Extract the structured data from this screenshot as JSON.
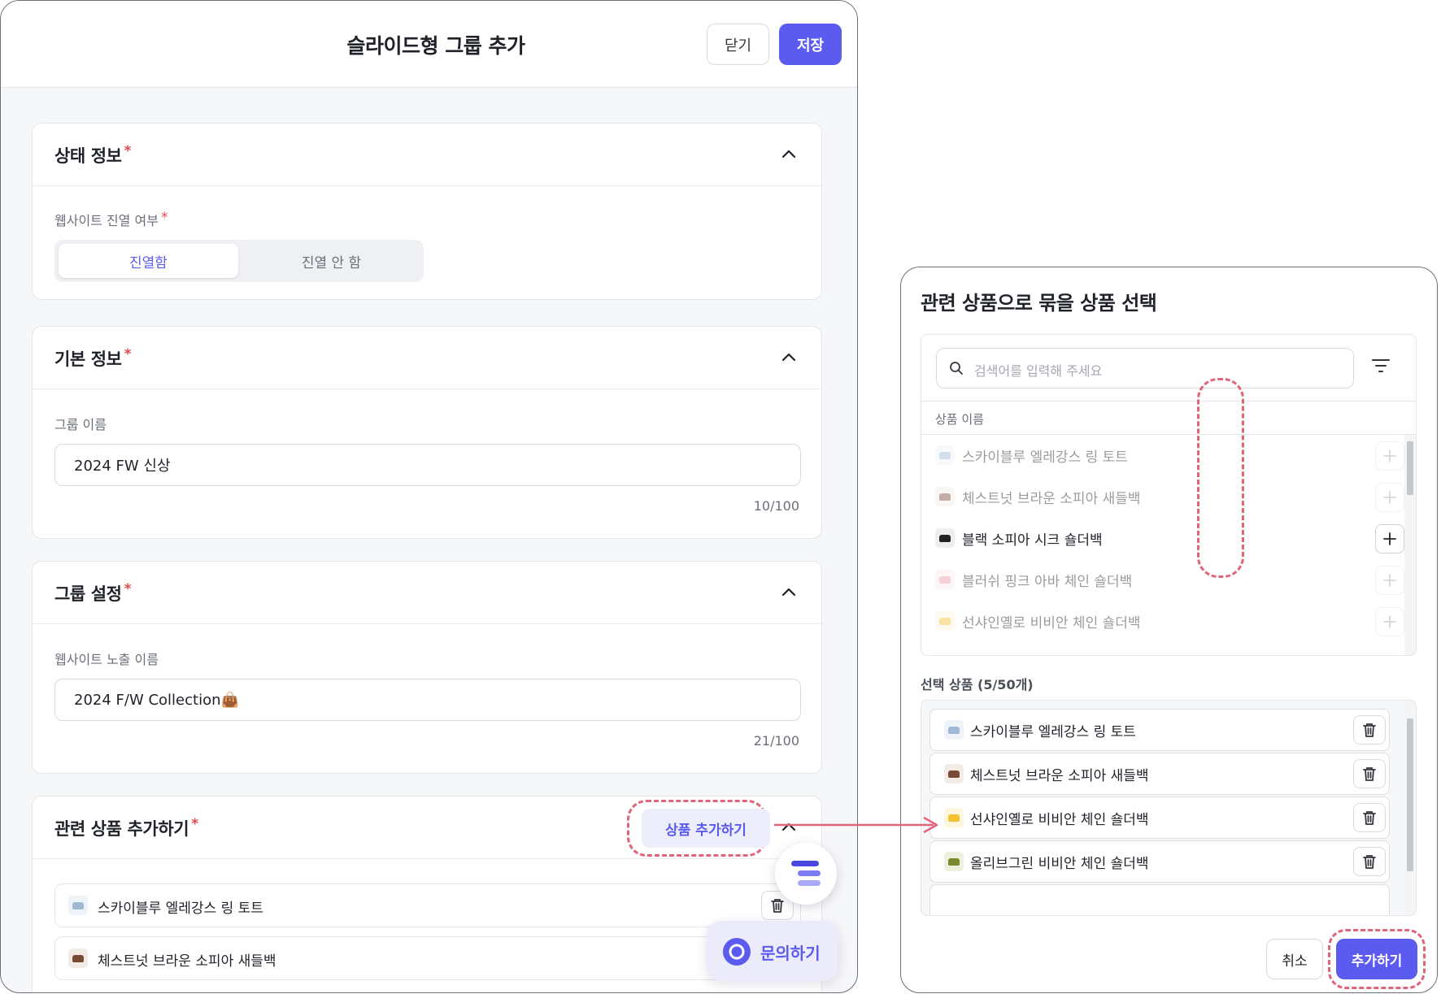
{
  "group_editor": {
    "title": "슬라이드형 그룹 추가",
    "close_label": "닫기",
    "save_label": "저장",
    "status_section": {
      "title": "상태 정보",
      "required_mark": "*",
      "display_label": "웹사이트 진열 여부",
      "display_on": "진열함",
      "display_off": "진열 안 함"
    },
    "basic_section": {
      "title": "기본 정보",
      "required_mark": "*",
      "group_name_label": "그룹 이름",
      "group_name_value": "2024 FW 신상",
      "group_name_count": "10/100"
    },
    "settings_section": {
      "title": "그룹 설정",
      "required_mark": "*",
      "exposure_label": "웹사이트 노출 이름",
      "exposure_value": "2024 F/W Collection👜",
      "exposure_count": "21/100"
    },
    "related_section": {
      "title": "관련 상품 추가하기",
      "required_mark": "*",
      "add_button": "상품 추가하기",
      "items": [
        {
          "name": "스카이블루 엘레강스 링 토트",
          "color": "#9fb8d6"
        },
        {
          "name": "체스트넛 브라운 소피아 새들백",
          "color": "#7a4a35"
        }
      ]
    },
    "inquiry_label": "문의하기"
  },
  "product_picker": {
    "title": "관련 상품으로 묶을 상품 선택",
    "search_placeholder": "검색어를 입력해 주세요",
    "column_header": "상품 이름",
    "list": [
      {
        "name": "스카이블루 엘레강스 링 토트",
        "color": "#9fb8d6",
        "selected": true
      },
      {
        "name": "체스트넛 브라운 소피아 새들백",
        "color": "#7a4a35",
        "selected": true
      },
      {
        "name": "블랙 소피아 시크 숄더백",
        "color": "#222222",
        "selected": false
      },
      {
        "name": "블러쉬 핑크 아바 체인 숄더백",
        "color": "#e79aa3",
        "selected": true
      },
      {
        "name": "선샤인옐로 비비안 체인 숄더백",
        "color": "#f2c230",
        "selected": true
      }
    ],
    "selected_label": "선택 상품 (5/50개)",
    "selected": [
      {
        "name": "스카이블루 엘레강스 링 토트",
        "color": "#9fb8d6"
      },
      {
        "name": "체스트넛 브라운 소피아 새들백",
        "color": "#7a4a35"
      },
      {
        "name": "선샤인옐로 비비안 체인 숄더백",
        "color": "#f2c230"
      },
      {
        "name": "올리브그린 비비안 체인 숄더백",
        "color": "#7c8a2e"
      }
    ],
    "cancel_label": "취소",
    "add_label": "추가하기"
  },
  "colors": {
    "accent": "#5b5bf0",
    "required": "#e5484d",
    "highlight_dash": "#e0647a"
  }
}
